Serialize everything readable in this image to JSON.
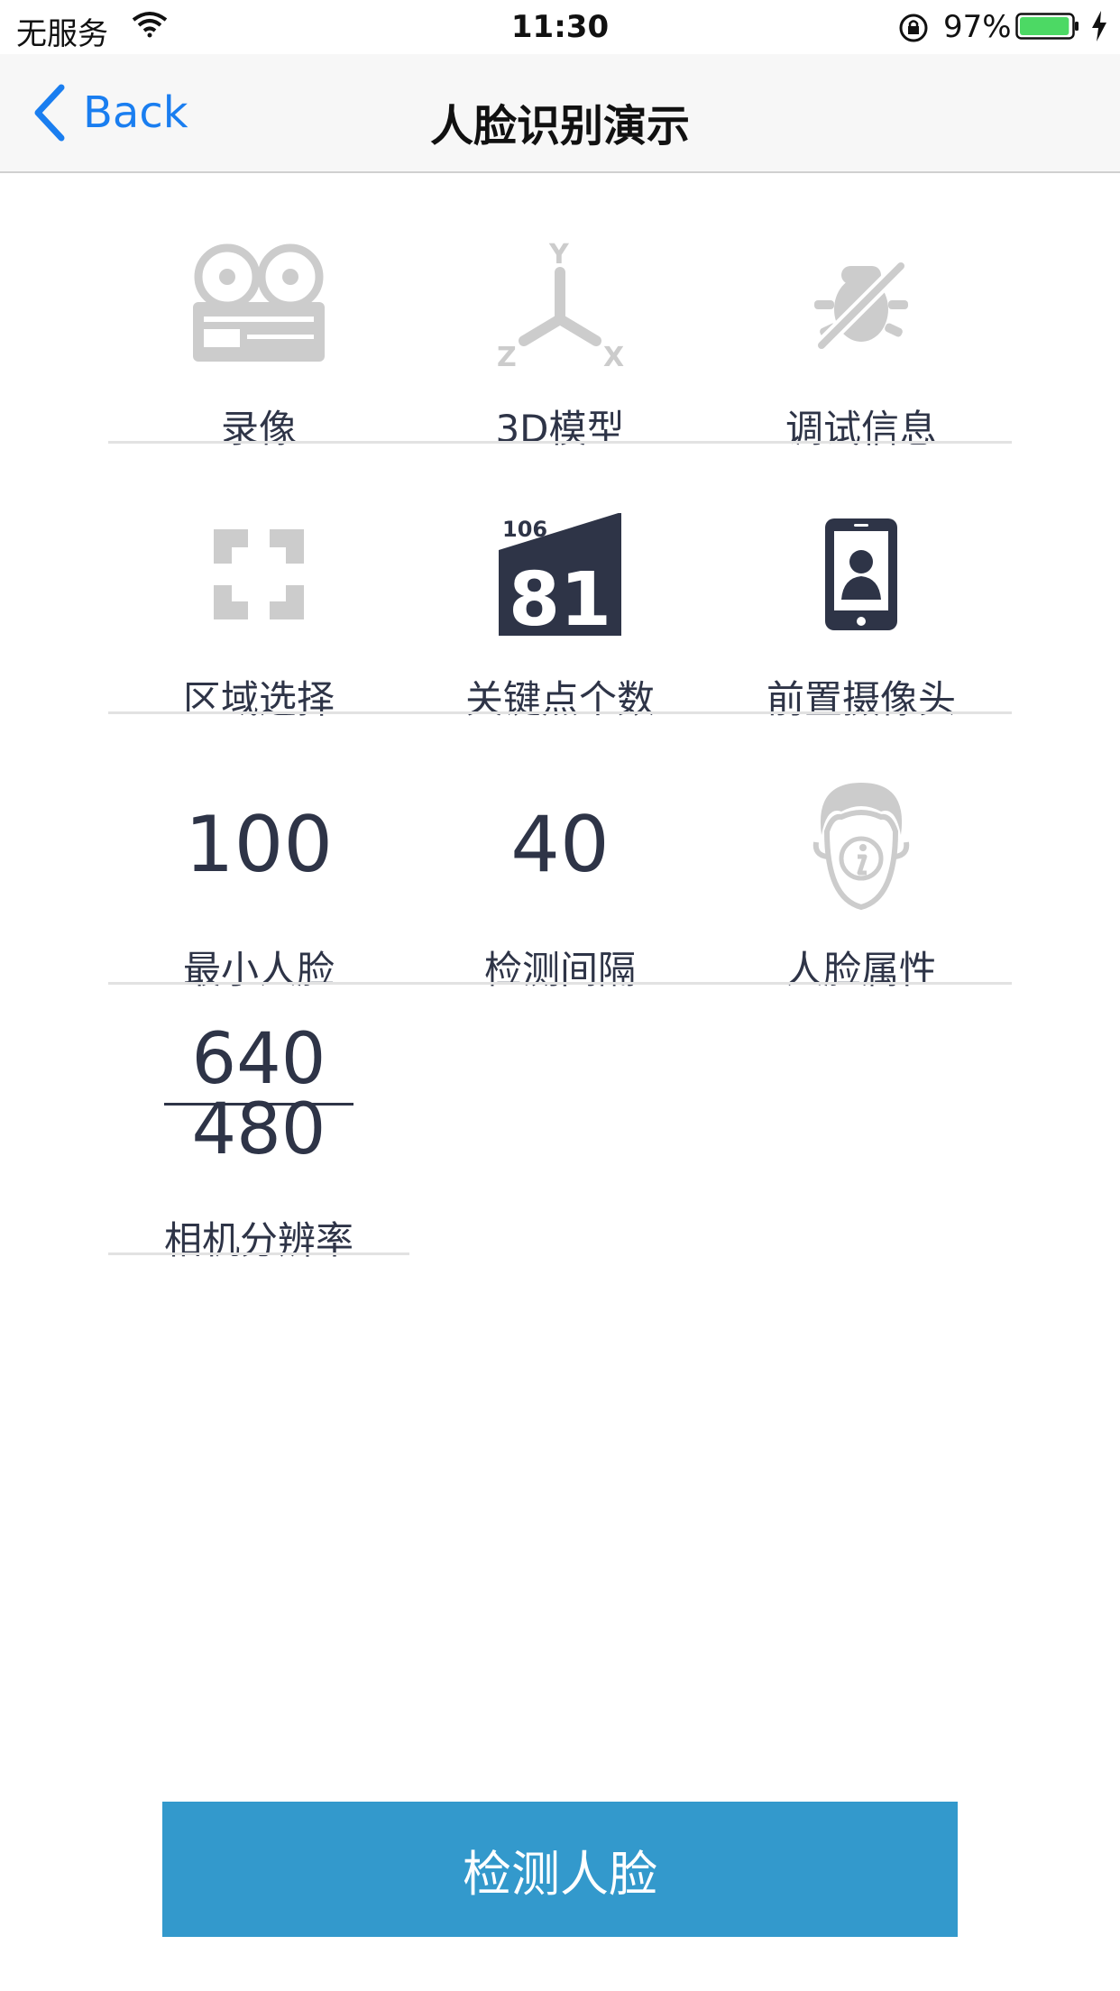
{
  "status_bar": {
    "carrier": "无服务",
    "time": "11:30",
    "battery_percent": "97%",
    "battery_level": 0.97
  },
  "nav": {
    "back_label": "Back",
    "title": "人脸识别演示"
  },
  "settings": [
    {
      "label": "录像",
      "icon": "tape-recorder-icon"
    },
    {
      "label": "3D模型",
      "icon": "xyz-axis-icon"
    },
    {
      "label": "调试信息",
      "icon": "debug-off-icon"
    },
    {
      "label": "区域选择",
      "icon": "region-select-icon"
    },
    {
      "label": "关键点个数",
      "icon": "landmark-count-icon",
      "badge_small": "106",
      "badge_large": "81"
    },
    {
      "label": "前置摄像头",
      "icon": "front-camera-phone-icon"
    },
    {
      "label": "最小人脸",
      "value": "100"
    },
    {
      "label": "检测间隔",
      "value": "40"
    },
    {
      "label": "人脸属性",
      "icon": "face-info-icon"
    },
    {
      "label": "相机分辨率",
      "numerator": "640",
      "denominator": "480"
    }
  ],
  "colors": {
    "accent": "#3399cc",
    "back_link": "#1a7ef0",
    "text": "#2e3447",
    "disabled_icon": "#cccccc",
    "battery": "#4cd964"
  },
  "detect_button": {
    "label": "检测人脸"
  }
}
